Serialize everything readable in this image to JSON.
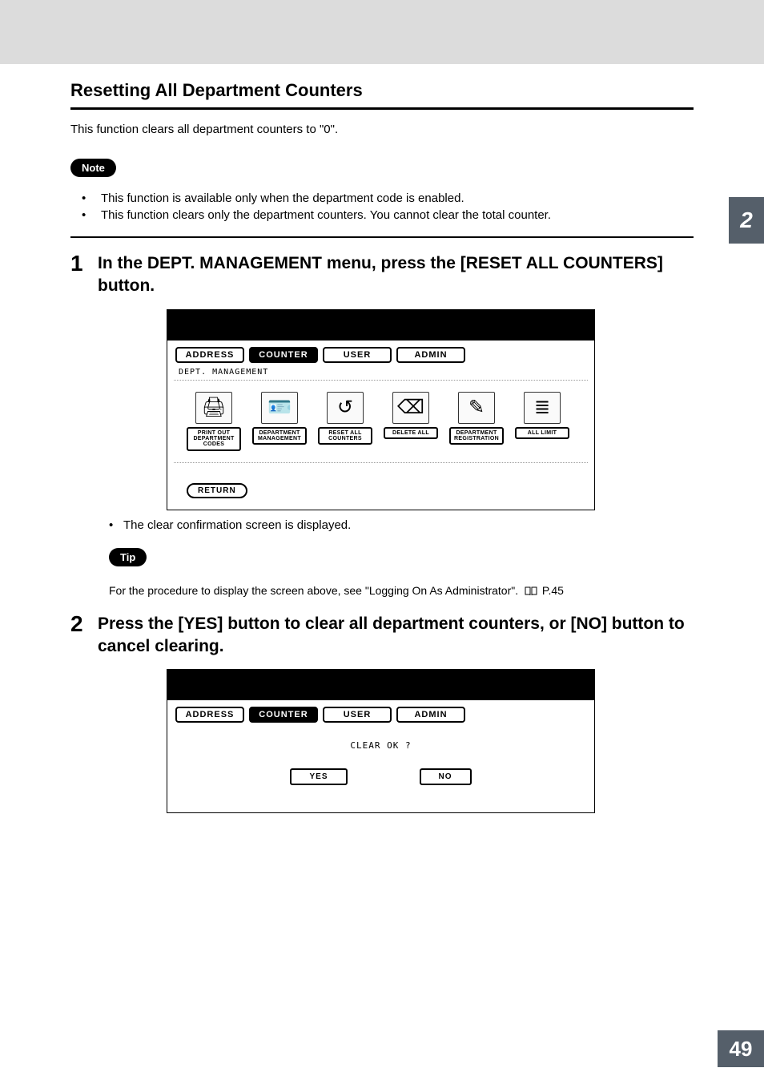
{
  "section_title": "Resetting All Department Counters",
  "intro": "This function clears all department counters to \"0\".",
  "note_label": "Note",
  "note_bullets": [
    "This function is available only when the department code is enabled.",
    "This function clears only the department counters.  You cannot clear the total counter."
  ],
  "steps": {
    "s1": {
      "num": "1",
      "text": "In the DEPT. MANAGEMENT menu, press the [RESET ALL COUNTERS] button."
    },
    "s2": {
      "num": "2",
      "text": "Press the [YES] button to clear all department counters, or [NO] button to cancel clearing."
    }
  },
  "panel1": {
    "tabs": {
      "address": "ADDRESS",
      "counter": "COUNTER",
      "user": "USER",
      "admin": "ADMIN"
    },
    "subtitle": "DEPT. MANAGEMENT",
    "icons": {
      "i0": "PRINT OUT DEPARTMENT CODES",
      "i1": "DEPARTMENT MANAGEMENT",
      "i2": "RESET ALL COUNTERS",
      "i3": "DELETE ALL",
      "i4": "DEPARTMENT REGISTRATION",
      "i5": "ALL LIMIT"
    },
    "return": "RETURN"
  },
  "after_panel1_bullet": "The clear confirmation screen is displayed.",
  "tip_label": "Tip",
  "tip_text_prefix": "For the procedure to display the screen above, see \"Logging On As Administrator\".",
  "tip_pageref": "P.45",
  "panel2": {
    "tabs": {
      "address": "ADDRESS",
      "counter": "COUNTER",
      "user": "USER",
      "admin": "ADMIN"
    },
    "question": "CLEAR OK ?",
    "yes": "YES",
    "no": "NO"
  },
  "chapter_tab": "2",
  "page_number": "49"
}
